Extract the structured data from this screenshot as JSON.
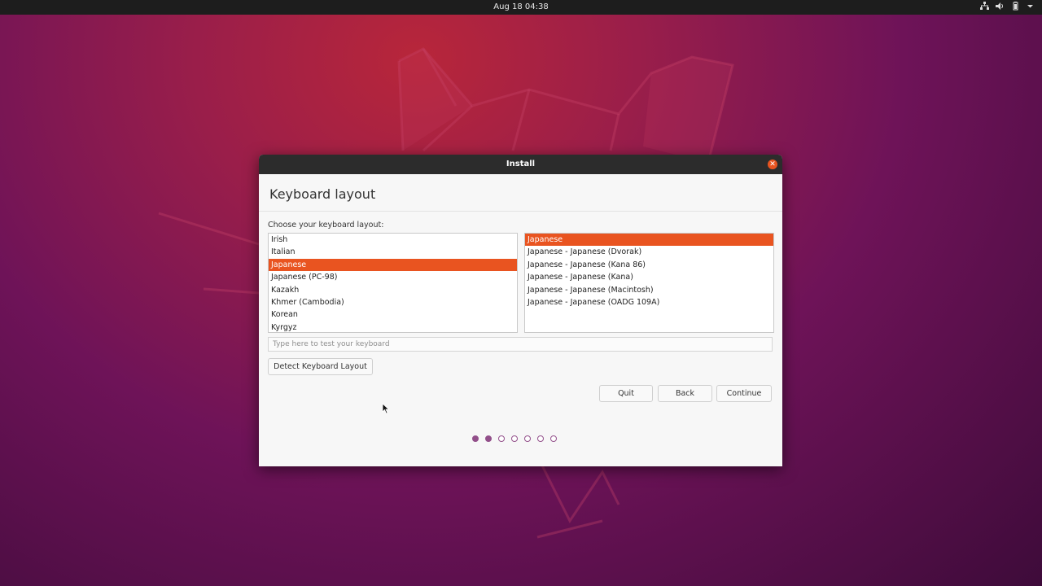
{
  "topbar": {
    "datetime": "Aug 18  04:38"
  },
  "tray": [
    "network-icon",
    "volume-icon",
    "battery-icon",
    "chevron-down-icon"
  ],
  "window": {
    "title": "Install",
    "heading": "Keyboard layout",
    "prompt": "Choose your keyboard layout:",
    "layouts": [
      "Irish",
      "Italian",
      "Japanese",
      "Japanese (PC-98)",
      "Kazakh",
      "Khmer (Cambodia)",
      "Korean",
      "Kyrgyz"
    ],
    "selected_layout": "Japanese",
    "variants": [
      "Japanese",
      "Japanese - Japanese (Dvorak)",
      "Japanese - Japanese (Kana 86)",
      "Japanese - Japanese (Kana)",
      "Japanese - Japanese (Macintosh)",
      "Japanese - Japanese (OADG 109A)"
    ],
    "selected_variant": "Japanese",
    "test_placeholder": "Type here to test your keyboard",
    "detect_label": "Detect Keyboard Layout",
    "quit_label": "Quit",
    "back_label": "Back",
    "continue_label": "Continue",
    "progress": {
      "total_steps": 7,
      "completed_steps": 2
    }
  },
  "colors": {
    "accent": "#e95420",
    "progress": "#924f8a",
    "titlebar": "#2c2c2c"
  }
}
